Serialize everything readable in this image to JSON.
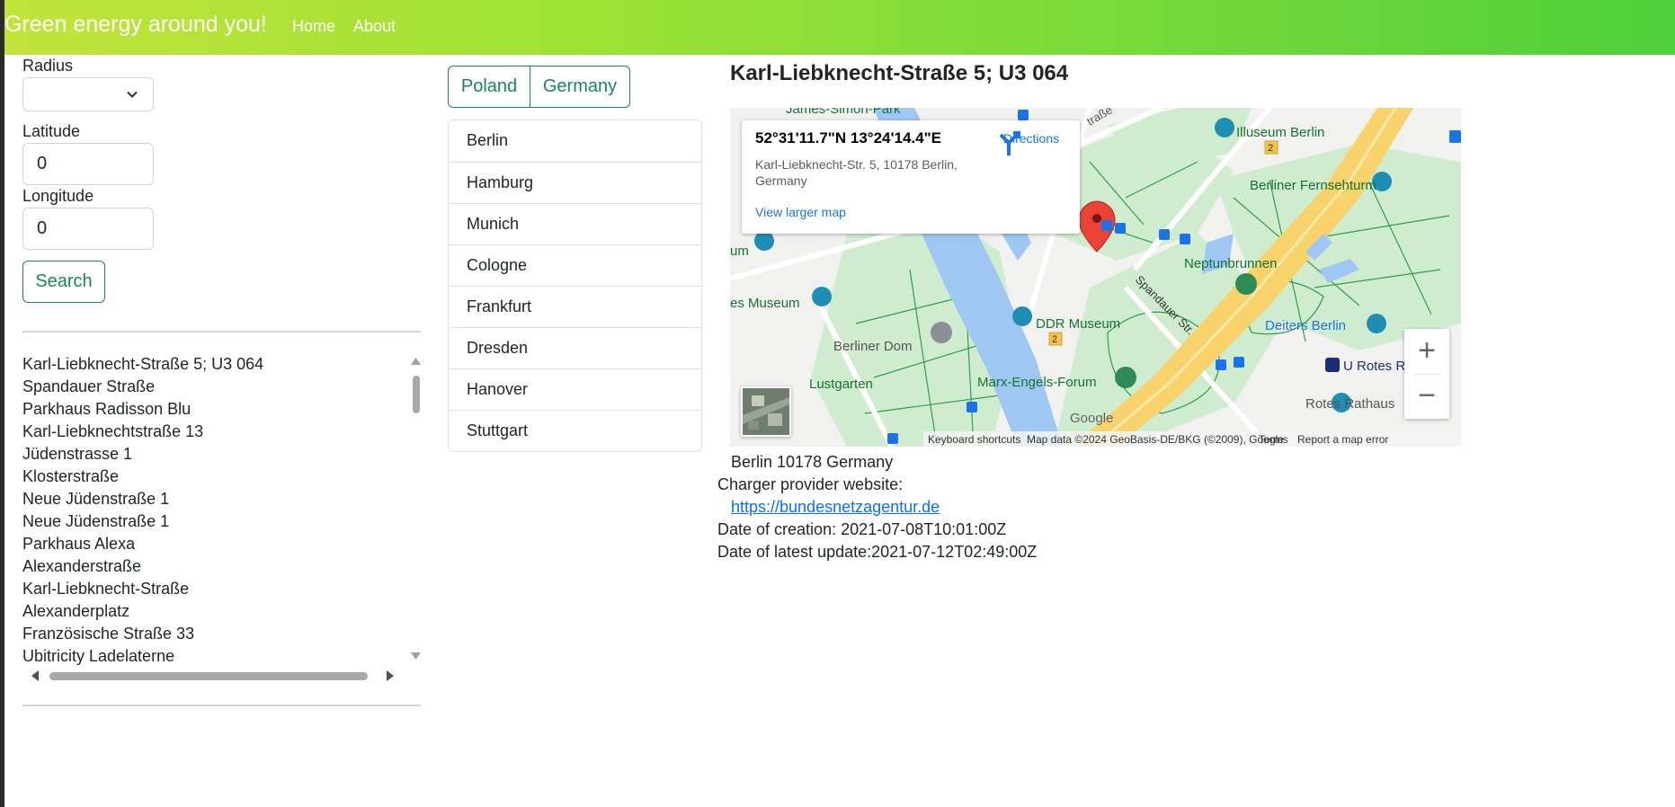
{
  "navbar": {
    "brand": "Green energy around you!",
    "links": [
      "Home",
      "About"
    ]
  },
  "form": {
    "radius_label": "Radius",
    "radius_value": "",
    "latitude_label": "Latitude",
    "latitude_value": "0",
    "longitude_label": "Longitude",
    "longitude_value": "0",
    "search_label": "Search"
  },
  "results": [
    "Karl-Liebknecht-Straße 5; U3 064",
    "Spandauer Straße",
    "Parkhaus Radisson Blu",
    "Karl-Liebknechtstraße 13",
    "Jüdenstrasse 1",
    "Klosterstraße",
    "Neue Jüdenstraße 1",
    "Neue Jüdenstraße 1",
    "Parkhaus Alexa",
    "Alexanderstraße",
    "Karl-Liebknecht-Straße",
    "Alexanderplatz",
    "Französische Straße 33",
    "Ubitricity Ladelaterne"
  ],
  "countries": [
    "Poland",
    "Germany"
  ],
  "cities": [
    "Berlin",
    "Hamburg",
    "Munich",
    "Cologne",
    "Frankfurt",
    "Dresden",
    "Hanover",
    "Stuttgart"
  ],
  "station": {
    "title": "Karl-Liebknecht-Straße 5; U3 064",
    "address_line": "Berlin 10178 Germany",
    "provider_label": "Charger provider website:",
    "provider_url": "https://bundesnetzagentur.de",
    "created": "Date of creation: 2021-07-08T10:01:00Z",
    "updated": "Date of latest update:2021-07-12T02:49:00Z"
  },
  "map": {
    "coordinates": "52°31'11.7\"N 13°24'14.4\"E",
    "address": "Karl-Liebknecht-Str. 5, 10178 Berlin, Germany",
    "directions": "Directions",
    "larger_map": "View larger map",
    "zoom_in": "+",
    "zoom_out": "−",
    "footer": {
      "shortcuts": "Keyboard shortcuts",
      "data": "Map data ©2024 GeoBasis-DE/BKG (©2009), Google",
      "terms": "Terms",
      "report": "Report a map error"
    },
    "labels": {
      "james_simon": "James-Simon-Park",
      "illuseum": "Illuseum Berlin",
      "fernsehturm": "Berliner Fernsehturm",
      "neptun": "Neptunbrunnen",
      "spandauer": "Spandauer Str.",
      "ddr": "DDR Museum",
      "deiters": "Deiters Berlin",
      "museum": "es Museum",
      "um": "um",
      "dom": "Berliner Dom",
      "lustgarten": "Lustgarten",
      "marx": "Marx-Engels-Forum",
      "rotes_rathaus": "Rotes Rathaus",
      "u_rotes": "U Rotes Rathaus",
      "strasse": "traße",
      "road_num": "2",
      "google": "Google"
    },
    "colors": {
      "water": "#9ec7f3",
      "park": "#cfeccf",
      "major_road": "#f8d36b",
      "park_path": "#2f9e4a",
      "pin": "#ea4335",
      "link": "#1a73e8"
    }
  }
}
